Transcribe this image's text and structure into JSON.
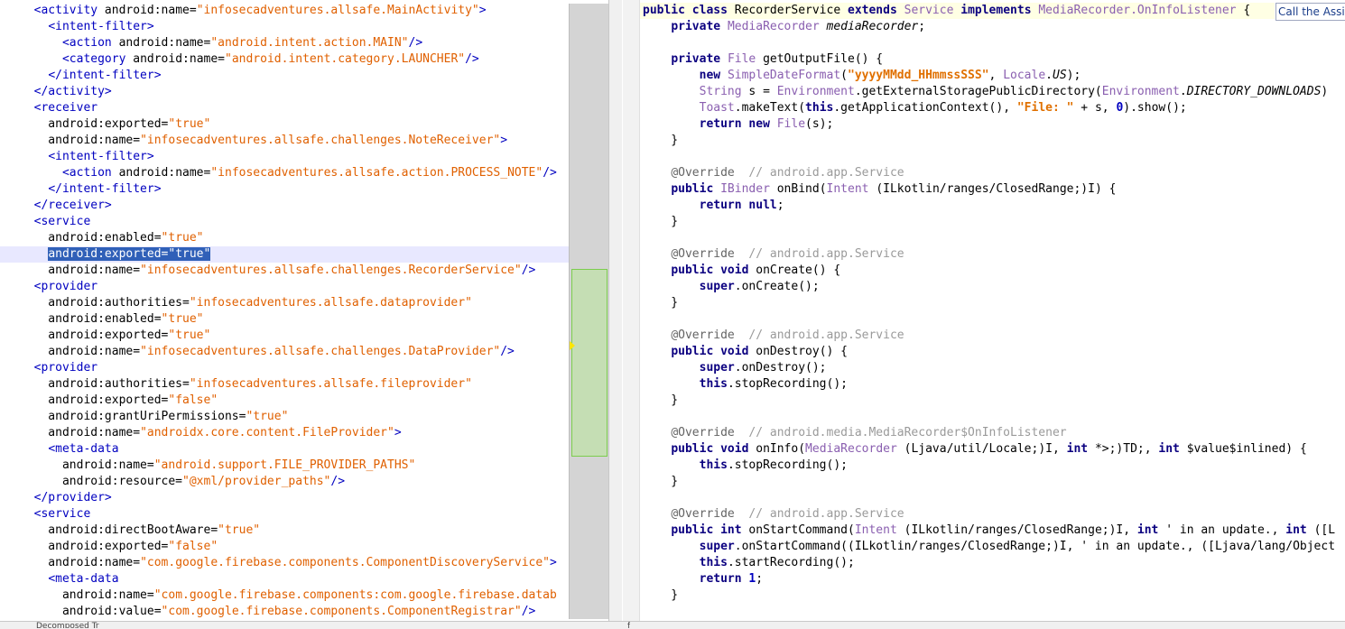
{
  "left_lines": [
    [
      {
        "t": "  ",
        "c": "plain"
      },
      {
        "t": "<activity",
        "c": "tag"
      },
      {
        "t": " android:name=",
        "c": "attr"
      },
      {
        "t": "\"infosecadventures.allsafe.MainActivity\"",
        "c": "val"
      },
      {
        "t": ">",
        "c": "tag"
      }
    ],
    [
      {
        "t": "    ",
        "c": "plain"
      },
      {
        "t": "<intent-filter>",
        "c": "tag"
      }
    ],
    [
      {
        "t": "      ",
        "c": "plain"
      },
      {
        "t": "<action",
        "c": "tag"
      },
      {
        "t": " android:name=",
        "c": "attr"
      },
      {
        "t": "\"android.intent.action.MAIN\"",
        "c": "val"
      },
      {
        "t": "/>",
        "c": "tag"
      }
    ],
    [
      {
        "t": "      ",
        "c": "plain"
      },
      {
        "t": "<category",
        "c": "tag"
      },
      {
        "t": " android:name=",
        "c": "attr"
      },
      {
        "t": "\"android.intent.category.LAUNCHER\"",
        "c": "val"
      },
      {
        "t": "/>",
        "c": "tag"
      }
    ],
    [
      {
        "t": "    ",
        "c": "plain"
      },
      {
        "t": "</intent-filter>",
        "c": "tag"
      }
    ],
    [
      {
        "t": "  ",
        "c": "plain"
      },
      {
        "t": "</activity>",
        "c": "tag"
      }
    ],
    [
      {
        "t": "  ",
        "c": "plain"
      },
      {
        "t": "<receiver",
        "c": "tag"
      }
    ],
    [
      {
        "t": "    android:exported=",
        "c": "attr"
      },
      {
        "t": "\"true\"",
        "c": "val"
      }
    ],
    [
      {
        "t": "    android:name=",
        "c": "attr"
      },
      {
        "t": "\"infosecadventures.allsafe.challenges.NoteReceiver\"",
        "c": "val"
      },
      {
        "t": ">",
        "c": "tag"
      }
    ],
    [
      {
        "t": "    ",
        "c": "plain"
      },
      {
        "t": "<intent-filter>",
        "c": "tag"
      }
    ],
    [
      {
        "t": "      ",
        "c": "plain"
      },
      {
        "t": "<action",
        "c": "tag"
      },
      {
        "t": " android:name=",
        "c": "attr"
      },
      {
        "t": "\"infosecadventures.allsafe.action.PROCESS_NOTE\"",
        "c": "val"
      },
      {
        "t": "/>",
        "c": "tag"
      }
    ],
    [
      {
        "t": "    ",
        "c": "plain"
      },
      {
        "t": "</intent-filter>",
        "c": "tag"
      }
    ],
    [
      {
        "t": "  ",
        "c": "plain"
      },
      {
        "t": "</receiver>",
        "c": "tag"
      }
    ],
    [
      {
        "t": "  ",
        "c": "plain"
      },
      {
        "t": "<service",
        "c": "tag"
      }
    ],
    [
      {
        "t": "    android:enabled=",
        "c": "attr"
      },
      {
        "t": "\"true\"",
        "c": "val"
      }
    ],
    [
      {
        "t": "    ",
        "c": "plain"
      },
      {
        "t": "android:exported=\"true\"",
        "c": "sel"
      }
    ],
    [
      {
        "t": "    android:name=",
        "c": "attr"
      },
      {
        "t": "\"infosecadventures.allsafe.challenges.RecorderService\"",
        "c": "val"
      },
      {
        "t": "/>",
        "c": "tag"
      }
    ],
    [
      {
        "t": "  ",
        "c": "plain"
      },
      {
        "t": "<provider",
        "c": "tag"
      }
    ],
    [
      {
        "t": "    android:authorities=",
        "c": "attr"
      },
      {
        "t": "\"infosecadventures.allsafe.dataprovider\"",
        "c": "val"
      }
    ],
    [
      {
        "t": "    android:enabled=",
        "c": "attr"
      },
      {
        "t": "\"true\"",
        "c": "val"
      }
    ],
    [
      {
        "t": "    android:exported=",
        "c": "attr"
      },
      {
        "t": "\"true\"",
        "c": "val"
      }
    ],
    [
      {
        "t": "    android:name=",
        "c": "attr"
      },
      {
        "t": "\"infosecadventures.allsafe.challenges.DataProvider\"",
        "c": "val"
      },
      {
        "t": "/>",
        "c": "tag"
      }
    ],
    [
      {
        "t": "  ",
        "c": "plain"
      },
      {
        "t": "<provider",
        "c": "tag"
      }
    ],
    [
      {
        "t": "    android:authorities=",
        "c": "attr"
      },
      {
        "t": "\"infosecadventures.allsafe.fileprovider\"",
        "c": "val"
      }
    ],
    [
      {
        "t": "    android:exported=",
        "c": "attr"
      },
      {
        "t": "\"false\"",
        "c": "val"
      }
    ],
    [
      {
        "t": "    android:grantUriPermissions=",
        "c": "attr"
      },
      {
        "t": "\"true\"",
        "c": "val"
      }
    ],
    [
      {
        "t": "    android:name=",
        "c": "attr"
      },
      {
        "t": "\"androidx.core.content.FileProvider\"",
        "c": "val"
      },
      {
        "t": ">",
        "c": "tag"
      }
    ],
    [
      {
        "t": "    ",
        "c": "plain"
      },
      {
        "t": "<meta-data",
        "c": "tag"
      }
    ],
    [
      {
        "t": "      android:name=",
        "c": "attr"
      },
      {
        "t": "\"android.support.FILE_PROVIDER_PATHS\"",
        "c": "val"
      }
    ],
    [
      {
        "t": "      android:resource=",
        "c": "attr"
      },
      {
        "t": "\"@xml/provider_paths\"",
        "c": "val"
      },
      {
        "t": "/>",
        "c": "tag"
      }
    ],
    [
      {
        "t": "  ",
        "c": "plain"
      },
      {
        "t": "</provider>",
        "c": "tag"
      }
    ],
    [
      {
        "t": "  ",
        "c": "plain"
      },
      {
        "t": "<service",
        "c": "tag"
      }
    ],
    [
      {
        "t": "    android:directBootAware=",
        "c": "attr"
      },
      {
        "t": "\"true\"",
        "c": "val"
      }
    ],
    [
      {
        "t": "    android:exported=",
        "c": "attr"
      },
      {
        "t": "\"false\"",
        "c": "val"
      }
    ],
    [
      {
        "t": "    android:name=",
        "c": "attr"
      },
      {
        "t": "\"com.google.firebase.components.ComponentDiscoveryService\"",
        "c": "val"
      },
      {
        "t": ">",
        "c": "tag"
      }
    ],
    [
      {
        "t": "    ",
        "c": "plain"
      },
      {
        "t": "<meta-data",
        "c": "tag"
      }
    ],
    [
      {
        "t": "      android:name=",
        "c": "attr"
      },
      {
        "t": "\"com.google.firebase.components:com.google.firebase.datab",
        "c": "val"
      }
    ],
    [
      {
        "t": "      android:value=",
        "c": "attr"
      },
      {
        "t": "\"com.google.firebase.components.ComponentRegistrar\"",
        "c": "val"
      },
      {
        "t": "/>",
        "c": "tag"
      }
    ]
  ],
  "right_lines": [
    [
      {
        "t": "public",
        "c": "kw"
      },
      {
        "t": " ",
        "c": "plain"
      },
      {
        "t": "class",
        "c": "kw"
      },
      {
        "t": " RecorderService ",
        "c": "plain"
      },
      {
        "t": "extends",
        "c": "kw"
      },
      {
        "t": " ",
        "c": "plain"
      },
      {
        "t": "Service",
        "c": "type"
      },
      {
        "t": " ",
        "c": "plain"
      },
      {
        "t": "implements",
        "c": "kw"
      },
      {
        "t": " ",
        "c": "plain"
      },
      {
        "t": "MediaRecorder.OnInfoListener",
        "c": "type"
      },
      {
        "t": " {",
        "c": "plain"
      }
    ],
    [
      {
        "t": "    ",
        "c": "plain"
      },
      {
        "t": "private",
        "c": "kw"
      },
      {
        "t": " ",
        "c": "plain"
      },
      {
        "t": "MediaRecorder",
        "c": "type"
      },
      {
        "t": " ",
        "c": "plain"
      },
      {
        "t": "mediaRecorder",
        "c": "ital"
      },
      {
        "t": ";",
        "c": "plain"
      }
    ],
    [
      {
        "t": "",
        "c": "plain"
      }
    ],
    [
      {
        "t": "    ",
        "c": "plain"
      },
      {
        "t": "private",
        "c": "kw"
      },
      {
        "t": " ",
        "c": "plain"
      },
      {
        "t": "File",
        "c": "type"
      },
      {
        "t": " getOutputFile() {",
        "c": "plain"
      }
    ],
    [
      {
        "t": "        ",
        "c": "plain"
      },
      {
        "t": "new",
        "c": "kw"
      },
      {
        "t": " ",
        "c": "plain"
      },
      {
        "t": "SimpleDateFormat",
        "c": "type"
      },
      {
        "t": "(",
        "c": "plain"
      },
      {
        "t": "\"yyyyMMdd_HHmmssSSS\"",
        "c": "str"
      },
      {
        "t": ", ",
        "c": "plain"
      },
      {
        "t": "Locale",
        "c": "type"
      },
      {
        "t": ".",
        "c": "plain"
      },
      {
        "t": "US",
        "c": "ital"
      },
      {
        "t": ");",
        "c": "plain"
      }
    ],
    [
      {
        "t": "        ",
        "c": "plain"
      },
      {
        "t": "String",
        "c": "type"
      },
      {
        "t": " s = ",
        "c": "plain"
      },
      {
        "t": "Environment",
        "c": "type"
      },
      {
        "t": ".getExternalStoragePublicDirectory(",
        "c": "plain"
      },
      {
        "t": "Environment",
        "c": "type"
      },
      {
        "t": ".",
        "c": "plain"
      },
      {
        "t": "DIRECTORY_DOWNLOADS",
        "c": "ital"
      },
      {
        "t": ")",
        "c": "plain"
      }
    ],
    [
      {
        "t": "        ",
        "c": "plain"
      },
      {
        "t": "Toast",
        "c": "type"
      },
      {
        "t": ".makeText(",
        "c": "plain"
      },
      {
        "t": "this",
        "c": "kw"
      },
      {
        "t": ".getApplicationContext(), ",
        "c": "plain"
      },
      {
        "t": "\"File: \"",
        "c": "str"
      },
      {
        "t": " + s, ",
        "c": "plain"
      },
      {
        "t": "0",
        "c": "num"
      },
      {
        "t": ").show();",
        "c": "plain"
      }
    ],
    [
      {
        "t": "        ",
        "c": "plain"
      },
      {
        "t": "return",
        "c": "kw"
      },
      {
        "t": " ",
        "c": "plain"
      },
      {
        "t": "new",
        "c": "kw"
      },
      {
        "t": " ",
        "c": "plain"
      },
      {
        "t": "File",
        "c": "type"
      },
      {
        "t": "(s);",
        "c": "plain"
      }
    ],
    [
      {
        "t": "    }",
        "c": "plain"
      }
    ],
    [
      {
        "t": "",
        "c": "plain"
      }
    ],
    [
      {
        "t": "    ",
        "c": "plain"
      },
      {
        "t": "@Override",
        "c": "ann"
      },
      {
        "t": "  // android.app.Service",
        "c": "cmt"
      }
    ],
    [
      {
        "t": "    ",
        "c": "plain"
      },
      {
        "t": "public",
        "c": "kw"
      },
      {
        "t": " ",
        "c": "plain"
      },
      {
        "t": "IBinder",
        "c": "type"
      },
      {
        "t": " onBind(",
        "c": "plain"
      },
      {
        "t": "Intent",
        "c": "type"
      },
      {
        "t": " (ILkotlin/ranges/ClosedRange;)I) {",
        "c": "plain"
      }
    ],
    [
      {
        "t": "        ",
        "c": "plain"
      },
      {
        "t": "return",
        "c": "kw"
      },
      {
        "t": " ",
        "c": "plain"
      },
      {
        "t": "null",
        "c": "kw"
      },
      {
        "t": ";",
        "c": "plain"
      }
    ],
    [
      {
        "t": "    }",
        "c": "plain"
      }
    ],
    [
      {
        "t": "",
        "c": "plain"
      }
    ],
    [
      {
        "t": "    ",
        "c": "plain"
      },
      {
        "t": "@Override",
        "c": "ann"
      },
      {
        "t": "  // android.app.Service",
        "c": "cmt"
      }
    ],
    [
      {
        "t": "    ",
        "c": "plain"
      },
      {
        "t": "public",
        "c": "kw"
      },
      {
        "t": " ",
        "c": "plain"
      },
      {
        "t": "void",
        "c": "kw"
      },
      {
        "t": " onCreate() {",
        "c": "plain"
      }
    ],
    [
      {
        "t": "        ",
        "c": "plain"
      },
      {
        "t": "super",
        "c": "kw"
      },
      {
        "t": ".onCreate();",
        "c": "plain"
      }
    ],
    [
      {
        "t": "    }",
        "c": "plain"
      }
    ],
    [
      {
        "t": "",
        "c": "plain"
      }
    ],
    [
      {
        "t": "    ",
        "c": "plain"
      },
      {
        "t": "@Override",
        "c": "ann"
      },
      {
        "t": "  // android.app.Service",
        "c": "cmt"
      }
    ],
    [
      {
        "t": "    ",
        "c": "plain"
      },
      {
        "t": "public",
        "c": "kw"
      },
      {
        "t": " ",
        "c": "plain"
      },
      {
        "t": "void",
        "c": "kw"
      },
      {
        "t": " onDestroy() {",
        "c": "plain"
      }
    ],
    [
      {
        "t": "        ",
        "c": "plain"
      },
      {
        "t": "super",
        "c": "kw"
      },
      {
        "t": ".onDestroy();",
        "c": "plain"
      }
    ],
    [
      {
        "t": "        ",
        "c": "plain"
      },
      {
        "t": "this",
        "c": "kw"
      },
      {
        "t": ".stopRecording();",
        "c": "plain"
      }
    ],
    [
      {
        "t": "    }",
        "c": "plain"
      }
    ],
    [
      {
        "t": "",
        "c": "plain"
      }
    ],
    [
      {
        "t": "    ",
        "c": "plain"
      },
      {
        "t": "@Override",
        "c": "ann"
      },
      {
        "t": "  // android.media.MediaRecorder$OnInfoListener",
        "c": "cmt"
      }
    ],
    [
      {
        "t": "    ",
        "c": "plain"
      },
      {
        "t": "public",
        "c": "kw"
      },
      {
        "t": " ",
        "c": "plain"
      },
      {
        "t": "void",
        "c": "kw"
      },
      {
        "t": " onInfo(",
        "c": "plain"
      },
      {
        "t": "MediaRecorder",
        "c": "type"
      },
      {
        "t": " (Ljava/util/Locale;)I, ",
        "c": "plain"
      },
      {
        "t": "int",
        "c": "kw"
      },
      {
        "t": " *>;)TD;, ",
        "c": "plain"
      },
      {
        "t": "int",
        "c": "kw"
      },
      {
        "t": " $value$inlined) {",
        "c": "plain"
      }
    ],
    [
      {
        "t": "        ",
        "c": "plain"
      },
      {
        "t": "this",
        "c": "kw"
      },
      {
        "t": ".stopRecording();",
        "c": "plain"
      }
    ],
    [
      {
        "t": "    }",
        "c": "plain"
      }
    ],
    [
      {
        "t": "",
        "c": "plain"
      }
    ],
    [
      {
        "t": "    ",
        "c": "plain"
      },
      {
        "t": "@Override",
        "c": "ann"
      },
      {
        "t": "  // android.app.Service",
        "c": "cmt"
      }
    ],
    [
      {
        "t": "    ",
        "c": "plain"
      },
      {
        "t": "public",
        "c": "kw"
      },
      {
        "t": " ",
        "c": "plain"
      },
      {
        "t": "int",
        "c": "kw"
      },
      {
        "t": " onStartCommand(",
        "c": "plain"
      },
      {
        "t": "Intent",
        "c": "type"
      },
      {
        "t": " (ILkotlin/ranges/ClosedRange;)I, ",
        "c": "plain"
      },
      {
        "t": "int",
        "c": "kw"
      },
      {
        "t": " ' in an update., ",
        "c": "plain"
      },
      {
        "t": "int",
        "c": "kw"
      },
      {
        "t": " ([L",
        "c": "plain"
      }
    ],
    [
      {
        "t": "        ",
        "c": "plain"
      },
      {
        "t": "super",
        "c": "kw"
      },
      {
        "t": ".onStartCommand((ILkotlin/ranges/ClosedRange;)I, ' in an update., ([Ljava/lang/Object",
        "c": "plain"
      }
    ],
    [
      {
        "t": "        ",
        "c": "plain"
      },
      {
        "t": "this",
        "c": "kw"
      },
      {
        "t": ".startRecording();",
        "c": "plain"
      }
    ],
    [
      {
        "t": "        ",
        "c": "plain"
      },
      {
        "t": "return",
        "c": "kw"
      },
      {
        "t": " ",
        "c": "plain"
      },
      {
        "t": "1",
        "c": "num"
      },
      {
        "t": ";",
        "c": "plain"
      }
    ],
    [
      {
        "t": "    }",
        "c": "plain"
      }
    ]
  ],
  "assist_hint": "Call the Assis",
  "bottom_tabs": {
    "left": "Decomposed Tr",
    "right": "f"
  }
}
